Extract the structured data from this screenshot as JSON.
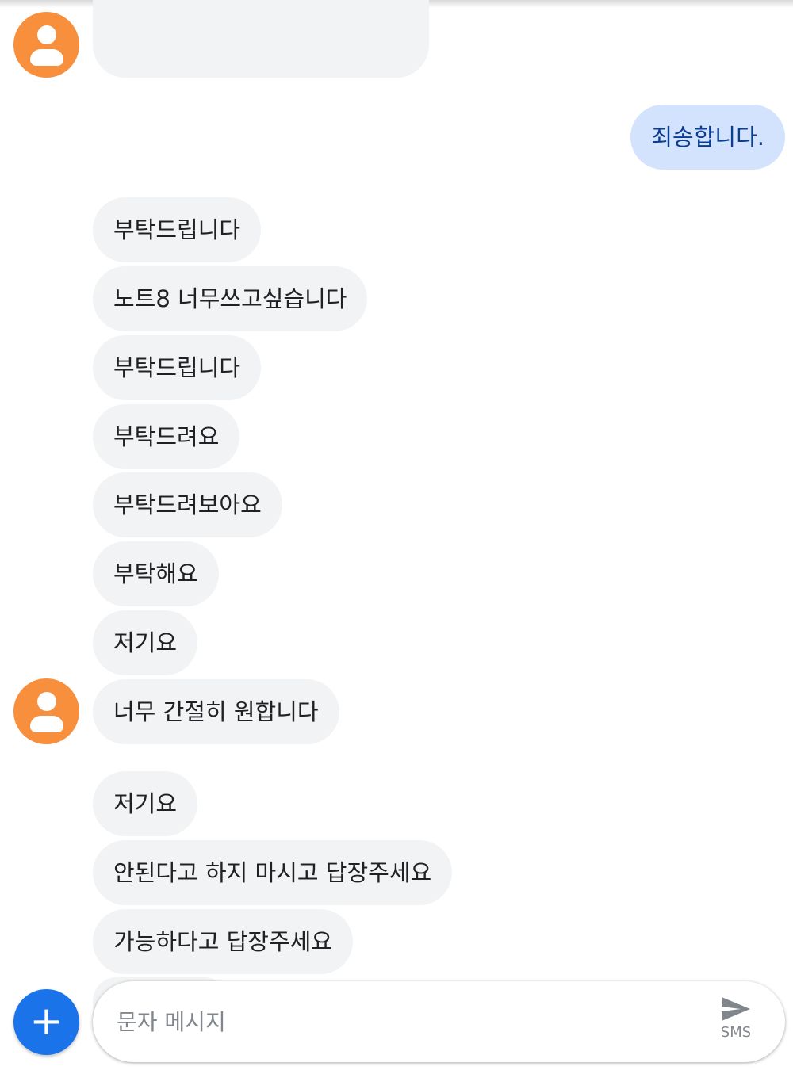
{
  "partial_top_message": "",
  "messages": [
    {
      "dir": "out",
      "text": "죄송합니다."
    },
    {
      "dir": "in",
      "text": "부탁드립니다"
    },
    {
      "dir": "in",
      "text": "노트8 너무쓰고싶습니다"
    },
    {
      "dir": "in",
      "text": "부탁드립니다"
    },
    {
      "dir": "in",
      "text": "부탁드려요"
    },
    {
      "dir": "in",
      "text": "부탁드려보아요"
    },
    {
      "dir": "in",
      "text": "부탁해요"
    },
    {
      "dir": "in",
      "text": "저기요"
    },
    {
      "dir": "in",
      "text": "너무 간절히 원합니다"
    },
    {
      "dir": "in",
      "text": "저기요"
    },
    {
      "dir": "in",
      "text": "안된다고 하지 마시고 답장주세요"
    },
    {
      "dir": "in",
      "text": "가능하다고 답장주세요"
    }
  ],
  "composer": {
    "placeholder": "문자 메시지",
    "value": "",
    "send_label": "SMS",
    "send_icon": "send-icon",
    "add_icon": "plus-icon"
  },
  "colors": {
    "incoming_bubble": "#f1f3f4",
    "outgoing_bubble": "#d3e3fd",
    "outgoing_text": "#0b3d91",
    "avatar": "#f78f3d",
    "fab": "#1a73e8"
  }
}
